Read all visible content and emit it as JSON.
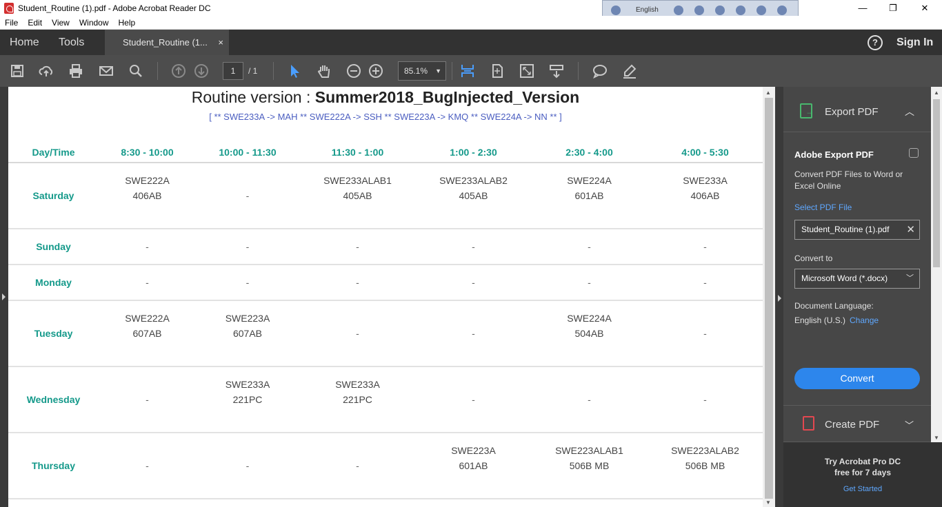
{
  "window": {
    "title": "Student_Routine (1).pdf - Adobe Acrobat Reader DC",
    "language_bar": "English",
    "controls": {
      "minimize": "—",
      "maximize": "❐",
      "close": "✕"
    }
  },
  "menu": [
    "File",
    "Edit",
    "View",
    "Window",
    "Help"
  ],
  "tabs": {
    "home": "Home",
    "tools": "Tools",
    "document_tab": "Student_Routine (1...",
    "close_glyph": "×",
    "help_glyph": "?",
    "sign_in": "Sign In"
  },
  "toolbar": {
    "page_current": "1",
    "page_total": "/ 1",
    "zoom": "85.1%",
    "icons": [
      "save-icon",
      "upload-icon",
      "print-icon",
      "email-icon",
      "search-icon",
      "page-up-icon",
      "page-down-icon",
      "select-arrow-icon",
      "hand-icon",
      "zoom-out-icon",
      "zoom-in-icon",
      "fit-width-icon",
      "fit-page-icon",
      "full-screen-icon",
      "read-mode-icon",
      "comment-icon",
      "highlight-icon"
    ]
  },
  "document": {
    "title_prefix": "Routine version : ",
    "title_bold": "Summer2018_BugInjected_Version",
    "subtitle": "[ ** SWE233A -> MAH ** SWE222A -> SSH ** SWE223A -> KMQ ** SWE224A -> NN ** ]",
    "headers": [
      "Day/Time",
      "8:30 - 10:00",
      "10:00 - 11:30",
      "11:30 - 1:00",
      "1:00 - 2:30",
      "2:30 - 4:00",
      "4:00 - 5:30"
    ],
    "rows": [
      {
        "day": "Saturday",
        "cells": [
          [
            "SWE222A",
            "406AB"
          ],
          [
            "-"
          ],
          [
            "SWE233ALAB1",
            "405AB"
          ],
          [
            "SWE233ALAB2",
            "405AB"
          ],
          [
            "SWE224A",
            "601AB"
          ],
          [
            "SWE233A",
            "406AB"
          ]
        ]
      },
      {
        "day": "Sunday",
        "cells": [
          [
            "-"
          ],
          [
            "-"
          ],
          [
            "-"
          ],
          [
            "-"
          ],
          [
            "-"
          ],
          [
            "-"
          ]
        ]
      },
      {
        "day": "Monday",
        "cells": [
          [
            "-"
          ],
          [
            "-"
          ],
          [
            "-"
          ],
          [
            "-"
          ],
          [
            "-"
          ],
          [
            "-"
          ]
        ]
      },
      {
        "day": "Tuesday",
        "cells": [
          [
            "SWE222A",
            "607AB"
          ],
          [
            "SWE223A",
            "607AB"
          ],
          [
            "-"
          ],
          [
            "-"
          ],
          [
            "SWE224A",
            "504AB"
          ],
          [
            "-"
          ]
        ]
      },
      {
        "day": "Wednesday",
        "cells": [
          [
            "-"
          ],
          [
            "SWE233A",
            "221PC"
          ],
          [
            "SWE233A",
            "221PC"
          ],
          [
            "-"
          ],
          [
            "-"
          ],
          [
            "-"
          ]
        ]
      },
      {
        "day": "Thursday",
        "cells": [
          [
            "-"
          ],
          [
            "-"
          ],
          [
            "-"
          ],
          [
            "SWE223A",
            "601AB"
          ],
          [
            "SWE223ALAB1",
            "506B MB"
          ],
          [
            "SWE223ALAB2",
            "506B MB"
          ]
        ]
      }
    ]
  },
  "panel": {
    "export_title": "Export PDF",
    "export_heading": "Adobe Export PDF",
    "export_desc": "Convert PDF Files to Word or Excel Online",
    "select_file_label": "Select PDF File",
    "selected_file": "Student_Routine (1).pdf",
    "convert_to_label": "Convert to",
    "convert_to_value": "Microsoft Word (*.docx)",
    "doc_language_label": "Document Language:",
    "doc_language_value": "English (U.S.)",
    "change_link": "Change",
    "convert_button": "Convert",
    "create_title": "Create PDF",
    "promo_line1": "Try Acrobat Pro DC",
    "promo_line2": "free for 7 days",
    "promo_link": "Get Started"
  },
  "colors": {
    "day_teal": "#14998a",
    "subtitle_blue": "#4a5dc0",
    "link_blue": "#5fa8ff",
    "button_blue": "#2d86ec",
    "export_green": "#49b86e",
    "create_red": "#e34850"
  }
}
